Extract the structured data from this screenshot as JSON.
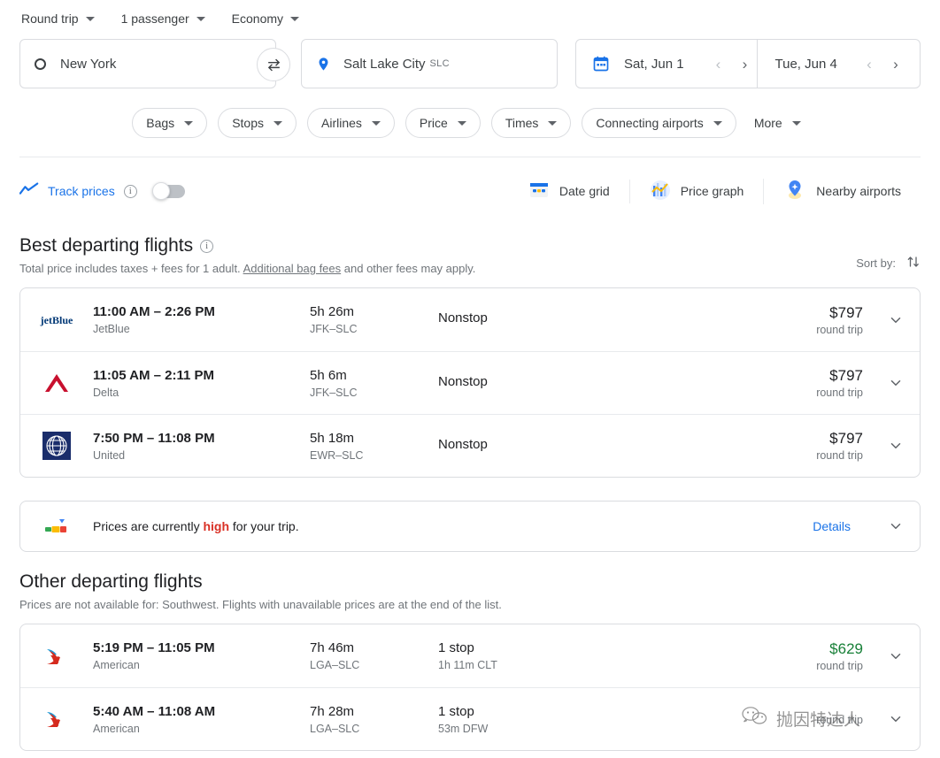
{
  "trip_options": [
    {
      "label": "Round trip",
      "name": "trip-type"
    },
    {
      "label": "1 passenger",
      "name": "passengers"
    },
    {
      "label": "Economy",
      "name": "cabin-class"
    }
  ],
  "search": {
    "origin": {
      "text": "New York",
      "code": ""
    },
    "destination": {
      "text": "Salt Lake City",
      "code": "SLC"
    },
    "swap_icon": "swap-icon",
    "depart_date": "Sat, Jun 1",
    "return_date": "Tue, Jun 4"
  },
  "filters": [
    {
      "label": "Bags",
      "bare": false
    },
    {
      "label": "Stops",
      "bare": false
    },
    {
      "label": "Airlines",
      "bare": false
    },
    {
      "label": "Price",
      "bare": false
    },
    {
      "label": "Times",
      "bare": false
    },
    {
      "label": "Connecting airports",
      "bare": false
    },
    {
      "label": "More",
      "bare": true
    }
  ],
  "tools": {
    "track_prices_label": "Track prices",
    "track_prices_enabled": false,
    "items": [
      {
        "label": "Date grid",
        "icon": "date-grid-icon"
      },
      {
        "label": "Price graph",
        "icon": "price-graph-icon"
      },
      {
        "label": "Nearby airports",
        "icon": "nearby-airports-icon"
      }
    ]
  },
  "best_section": {
    "title": "Best departing flights",
    "subtitle_before": "Total price includes taxes + fees for 1 adult. ",
    "subtitle_link": "Additional bag fees",
    "subtitle_after": " and other fees may apply.",
    "sort_label": "Sort by:",
    "flights": [
      {
        "airline_logo": "jetblue-logo",
        "times": "11:00 AM – 2:26 PM",
        "airline": "JetBlue",
        "duration": "5h 26m",
        "route": "JFK–SLC",
        "stops": "Nonstop",
        "stops_detail": "",
        "price": "$797",
        "price_sub": "round trip",
        "price_green": false
      },
      {
        "airline_logo": "delta-logo",
        "times": "11:05 AM – 2:11 PM",
        "airline": "Delta",
        "duration": "5h 6m",
        "route": "JFK–SLC",
        "stops": "Nonstop",
        "stops_detail": "",
        "price": "$797",
        "price_sub": "round trip",
        "price_green": false
      },
      {
        "airline_logo": "united-logo",
        "times": "7:50 PM – 11:08 PM",
        "airline": "United",
        "duration": "5h 18m",
        "route": "EWR–SLC",
        "stops": "Nonstop",
        "stops_detail": "",
        "price": "$797",
        "price_sub": "round trip",
        "price_green": false
      }
    ]
  },
  "price_banner": {
    "icon": "price-gauge-icon",
    "text_before": "Prices are currently ",
    "highlight": "high",
    "text_after": " for your trip.",
    "details_label": "Details"
  },
  "other_section": {
    "title": "Other departing flights",
    "subtitle": "Prices are not available for: Southwest. Flights with unavailable prices are at the end of the list.",
    "flights": [
      {
        "airline_logo": "american-logo",
        "times": "5:19 PM – 11:05 PM",
        "airline": "American",
        "duration": "7h 46m",
        "route": "LGA–SLC",
        "stops": "1 stop",
        "stops_detail": "1h 11m CLT",
        "price": "$629",
        "price_sub": "round trip",
        "price_green": true
      },
      {
        "airline_logo": "american-logo",
        "times": "5:40 AM – 11:08 AM",
        "airline": "American",
        "duration": "7h 28m",
        "route": "LGA–SLC",
        "stops": "1 stop",
        "stops_detail": "53m DFW",
        "price": "",
        "price_sub": "round trip",
        "price_green": false
      }
    ]
  },
  "watermark": {
    "icon": "wechat-icon",
    "text": "抛因特达人"
  },
  "colors": {
    "accent_blue": "#1a73e8",
    "price_green": "#188038",
    "alert_red": "#d93025",
    "border": "#dadce0"
  }
}
